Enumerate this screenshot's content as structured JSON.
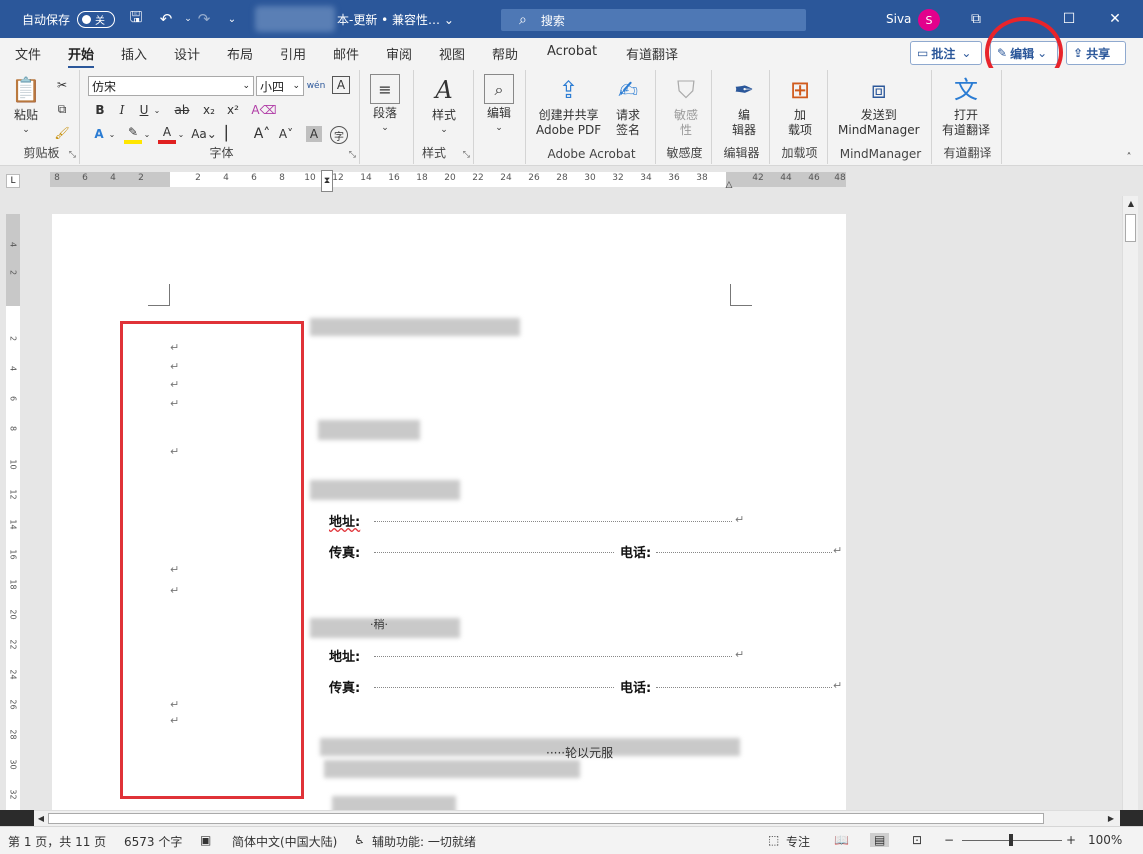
{
  "titlebar": {
    "autosave_label": "自动保存",
    "autosave_state": "关",
    "doc_title": "本-更新 • 兼容性… ⌄",
    "search_label": "搜索",
    "user_name": "Siva",
    "avatar_initial": "S"
  },
  "tabs": [
    "文件",
    "开始",
    "插入",
    "设计",
    "布局",
    "引用",
    "邮件",
    "审阅",
    "视图",
    "帮助",
    "Acrobat",
    "有道翻译"
  ],
  "header_buttons": {
    "comments": "批注",
    "editing": "编辑",
    "share": "共享"
  },
  "ribbon": {
    "clipboard": {
      "paste": "粘贴",
      "label": "剪贴板"
    },
    "font": {
      "family": "仿宋",
      "size": "小四",
      "label": "字体"
    },
    "paragraph": {
      "button": "段落",
      "label": ""
    },
    "styles": {
      "button": "样式",
      "label": "样式"
    },
    "editing": {
      "button": "编辑",
      "label": ""
    },
    "acrobat": {
      "create_line1": "创建并共享",
      "create_line2": "Adobe PDF",
      "request_line1": "请求",
      "request_line2": "签名",
      "label": "Adobe Acrobat"
    },
    "sensitivity": {
      "line1": "敏感",
      "line2": "性",
      "label": "敏感度"
    },
    "editor": {
      "line1": "编",
      "line2": "辑器",
      "label": "编辑器"
    },
    "addins": {
      "line1": "加",
      "line2": "载项",
      "label": "加载项"
    },
    "mindmanager": {
      "line1": "发送到",
      "line2": "MindManager",
      "label": "MindManager"
    },
    "youdao": {
      "line1": "打开",
      "line2": "有道翻译",
      "label": "有道翻译"
    }
  },
  "ruler_ticks": [
    "8",
    "6",
    "4",
    "2",
    "2",
    "4",
    "6",
    "8",
    "10",
    "12",
    "14",
    "16",
    "18",
    "20",
    "22",
    "24",
    "26",
    "28",
    "30",
    "32",
    "34",
    "36",
    "38",
    "42",
    "44",
    "46",
    "48"
  ],
  "vruler_ticks": [
    "4",
    "2",
    "2",
    "4",
    "6",
    "8",
    "10",
    "12",
    "14",
    "16",
    "18",
    "20",
    "22",
    "24",
    "26",
    "28",
    "30",
    "32"
  ],
  "document": {
    "para_mark": "↵",
    "address_label": "地址:",
    "fax_label": "传真:",
    "phone_label": "电话:",
    "fragment_1": "·稍·",
    "fragment_2": "·····轮以元服"
  },
  "statusbar": {
    "page": "第 1 页，共 11 页",
    "words": "6573 个字",
    "language": "简体中文(中国大陆)",
    "accessibility": "辅助功能: 一切就绪",
    "focus": "专注",
    "zoom": "100%"
  },
  "colors": {
    "brand": "#2b579a",
    "highlight_red": "#e03238",
    "avatar": "#e3008c"
  }
}
